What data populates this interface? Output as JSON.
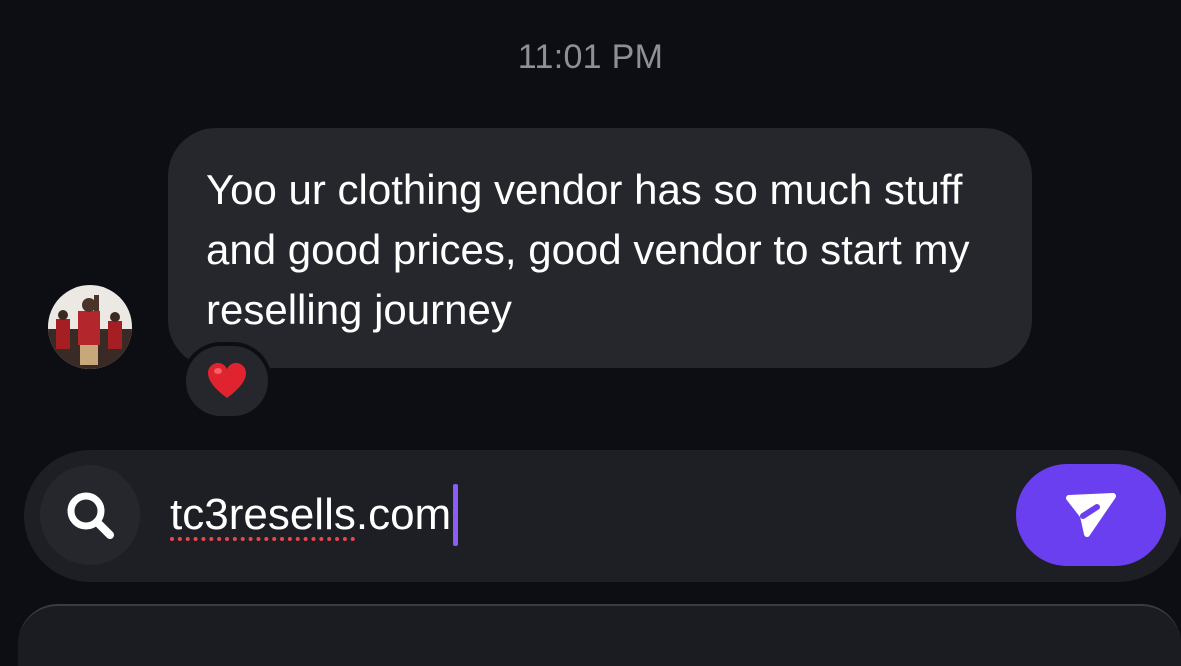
{
  "thread": {
    "timestamp": "11:01 PM"
  },
  "message": {
    "text": "Yoo ur clothing vendor has so much stuff and good prices, good vendor to start my reselling journey",
    "sender_avatar": "sender-avatar",
    "reaction": "❤️"
  },
  "composer": {
    "search_icon": "search-icon",
    "input_value_underlined": "tc3resells",
    "input_value_rest": ".com",
    "send_icon": "send-icon",
    "accent_color": "#6a3ff0"
  },
  "colors": {
    "background": "#0c0e14",
    "bubble": "#25272c",
    "spellcheck_underline": "#e5484d",
    "caret": "#8b5cf6"
  }
}
